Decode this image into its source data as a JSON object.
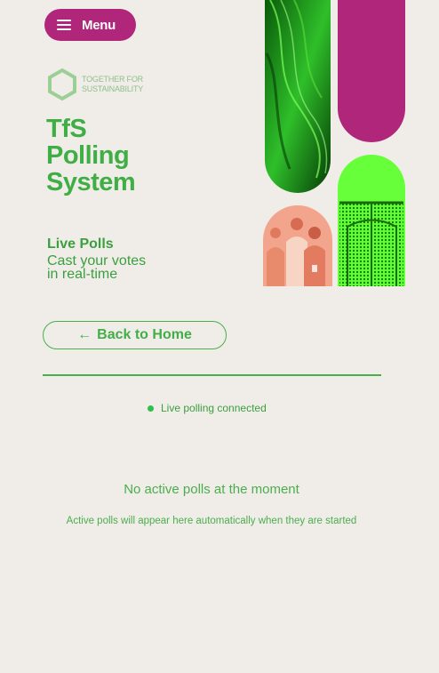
{
  "header": {
    "menu_label": "Menu",
    "menu_icon": "hamburger-icon"
  },
  "logo": {
    "line1": "TOGETHER FOR",
    "line2": "SUSTAINABILITY",
    "icon": "hexagon-logo-icon"
  },
  "hero": {
    "title_line1": "TfS",
    "title_line2": "Polling",
    "title_line3": "System",
    "section_title": "Live Polls",
    "tagline_line1": "Cast your votes",
    "tagline_line2": "in real-time"
  },
  "nav": {
    "back_label": "Back to Home",
    "back_icon": "arrow-left-icon"
  },
  "status": {
    "text": "Live polling connected",
    "color": "#2fbf4a"
  },
  "empty_state": {
    "title": "No active polls at the moment",
    "subtitle": "Active polls will appear here automatically when they are started"
  },
  "colors": {
    "background": "#f0ede8",
    "brand_green": "#46b04a",
    "brand_magenta": "#b0267a",
    "bright_green": "#66ff3a",
    "coral": "#f08060"
  }
}
